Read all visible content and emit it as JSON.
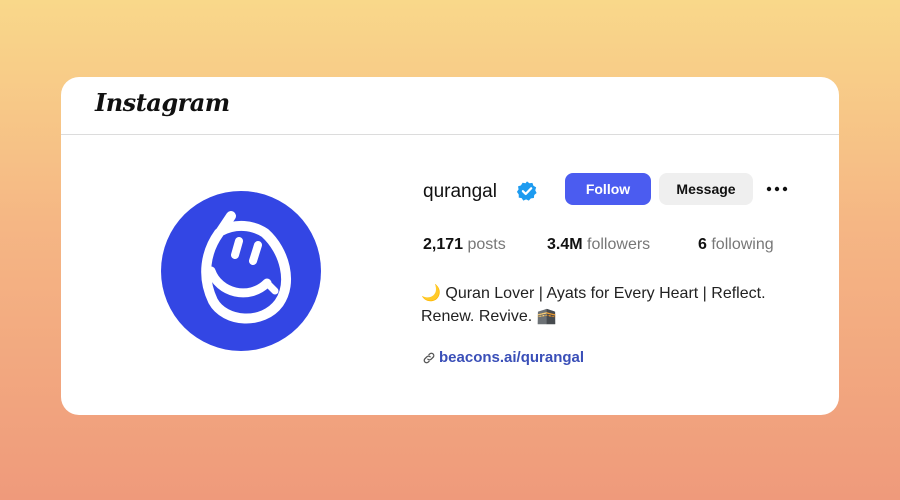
{
  "header": {
    "logo_text": "Instagram"
  },
  "profile": {
    "username": "qurangal",
    "verified_icon": "verified-badge-icon",
    "buttons": {
      "follow": "Follow",
      "message": "Message",
      "more_icon": "more-options-icon"
    },
    "stats": {
      "posts_count": "2,171",
      "posts_label": "posts",
      "followers_count": "3.4M",
      "followers_label": "followers",
      "following_count": "6",
      "following_label": "following"
    },
    "bio_line1": "🌙 Quran Lover | Ayats for Every Heart | Reflect.",
    "bio_line2": "Renew. Revive. 🕋",
    "link_icon": "link-icon",
    "link_text": "beacons.ai/qurangal"
  },
  "colors": {
    "accent": "#4b5cf0",
    "avatar_bg": "#3346e4",
    "verified": "#1d9bf0",
    "link": "#3a4fb8"
  }
}
